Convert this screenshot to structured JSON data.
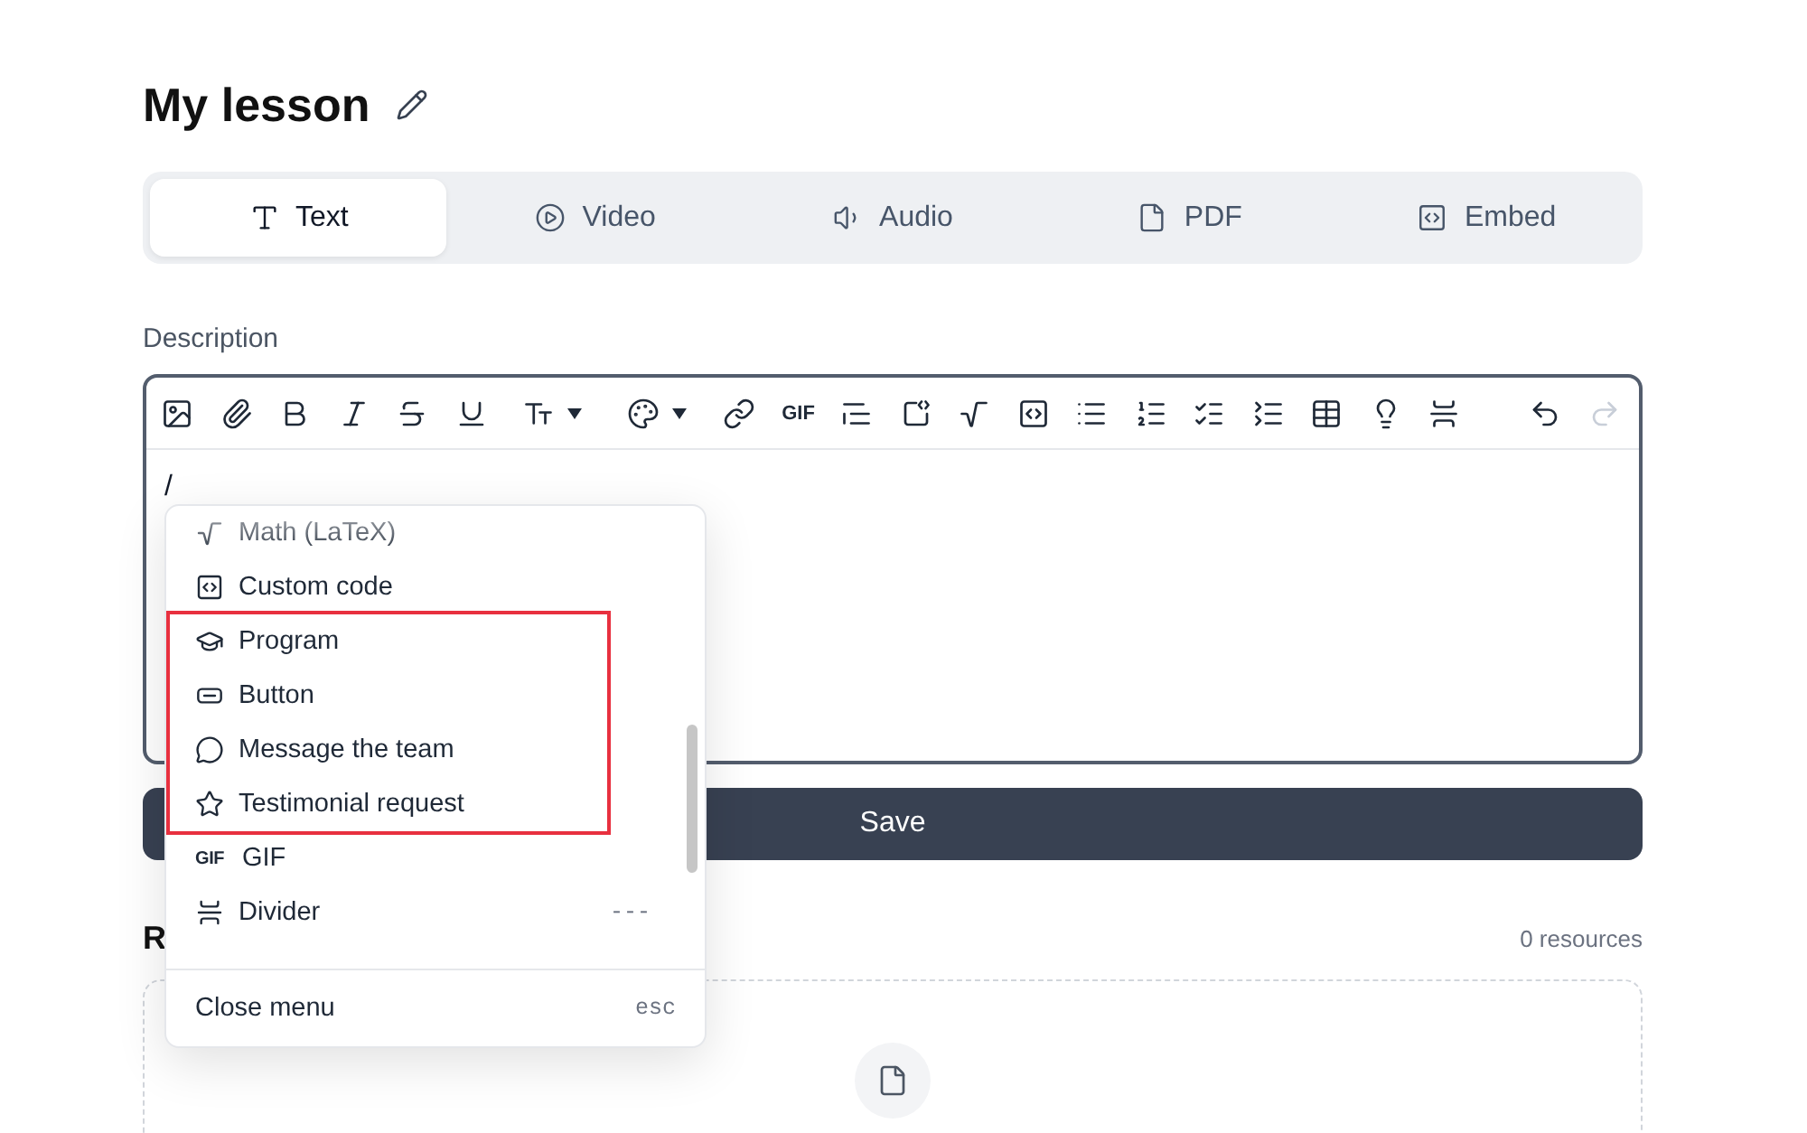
{
  "page": {
    "title": "My lesson"
  },
  "tabs": [
    {
      "kind": "text",
      "label": "Text",
      "selected": true
    },
    {
      "kind": "video",
      "label": "Video",
      "selected": false
    },
    {
      "kind": "audio",
      "label": "Audio",
      "selected": false
    },
    {
      "kind": "pdf",
      "label": "PDF",
      "selected": false
    },
    {
      "kind": "embed",
      "label": "Embed",
      "selected": false
    }
  ],
  "description": {
    "label": "Description",
    "value": "/"
  },
  "toolbar": {
    "items": [
      {
        "kind": "image"
      },
      {
        "kind": "attachment"
      },
      {
        "kind": "bold"
      },
      {
        "kind": "italic"
      },
      {
        "kind": "strikethrough"
      },
      {
        "kind": "underline"
      },
      {
        "kind": "text-size"
      },
      {
        "kind": "color"
      },
      {
        "kind": "link"
      },
      {
        "kind": "gif",
        "label": "GIF"
      },
      {
        "kind": "quote"
      },
      {
        "kind": "embed"
      },
      {
        "kind": "math"
      },
      {
        "kind": "code"
      },
      {
        "kind": "bullet-list"
      },
      {
        "kind": "numbered-list"
      },
      {
        "kind": "checklist"
      },
      {
        "kind": "toggle-list"
      },
      {
        "kind": "table"
      },
      {
        "kind": "callout"
      },
      {
        "kind": "divider"
      }
    ],
    "history": [
      {
        "kind": "undo",
        "disabled": false
      },
      {
        "kind": "redo",
        "disabled": true
      }
    ]
  },
  "slash_menu": {
    "items": [
      {
        "kind": "math",
        "label": "Math (LaTeX)",
        "highlighted": false
      },
      {
        "kind": "code",
        "label": "Custom code",
        "highlighted": false
      },
      {
        "kind": "program",
        "label": "Program",
        "highlighted": true
      },
      {
        "kind": "button",
        "label": "Button",
        "highlighted": true
      },
      {
        "kind": "message",
        "label": "Message the team",
        "highlighted": true
      },
      {
        "kind": "testimonial",
        "label": "Testimonial request",
        "highlighted": true
      },
      {
        "kind": "gif",
        "icon_text": "GIF",
        "label": "GIF",
        "highlighted": false
      },
      {
        "kind": "divider",
        "label": "Divider",
        "shortcut": "---",
        "highlighted": false
      }
    ],
    "close": {
      "label": "Close menu",
      "shortcut": "esc"
    }
  },
  "save_button": {
    "label": "Save"
  },
  "resources": {
    "heading": "R",
    "count": "0 resources"
  }
}
